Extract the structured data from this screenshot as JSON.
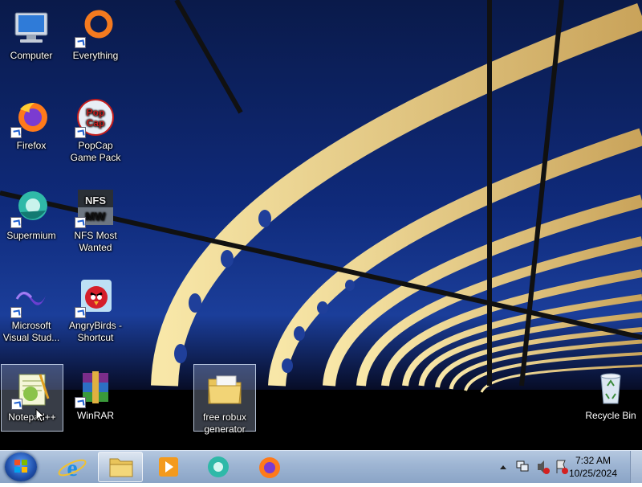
{
  "desktop": {
    "icons": [
      {
        "name": "Computer",
        "icon": "computer-icon",
        "shortcut": false
      },
      {
        "name": "Everything",
        "icon": "everything-icon",
        "shortcut": true
      },
      {
        "name": "Firefox",
        "icon": "firefox-icon",
        "shortcut": true
      },
      {
        "name": "PopCap Game Pack",
        "icon": "popcap-icon",
        "shortcut": true
      },
      {
        "name": "Supermium",
        "icon": "supermium-icon",
        "shortcut": true
      },
      {
        "name": "NFS Most Wanted",
        "icon": "nfs-icon",
        "shortcut": true
      },
      {
        "name": "Microsoft Visual Stud...",
        "icon": "visual-studio-icon",
        "shortcut": true
      },
      {
        "name": "AngryBirds - Shortcut",
        "icon": "angry-birds-icon",
        "shortcut": true
      },
      {
        "name": "Notepad++",
        "icon": "notepad-plus-plus-icon",
        "shortcut": true,
        "selected": true
      },
      {
        "name": "WinRAR",
        "icon": "winrar-icon",
        "shortcut": true
      },
      {
        "name": "free robux generator",
        "icon": "folder-icon",
        "shortcut": false,
        "selected": true
      },
      {
        "name": "Recycle Bin",
        "icon": "recycle-bin-icon",
        "shortcut": false
      }
    ]
  },
  "taskbar": {
    "start": "start-button",
    "pinned": [
      {
        "name": "Internet Explorer",
        "icon": "internet-explorer-icon"
      },
      {
        "name": "Windows Explorer",
        "icon": "file-explorer-icon",
        "active": true
      },
      {
        "name": "Windows Media Player",
        "icon": "media-player-icon"
      },
      {
        "name": "Supermium",
        "icon": "supermium-icon"
      },
      {
        "name": "Firefox",
        "icon": "firefox-icon"
      }
    ],
    "tray": {
      "time": "7:32 AM",
      "date": "10/25/2024"
    }
  },
  "colors": {
    "taskbar": "#9fb6d4",
    "sky": "#0f2a7a",
    "bridge": "#f2d98a"
  }
}
